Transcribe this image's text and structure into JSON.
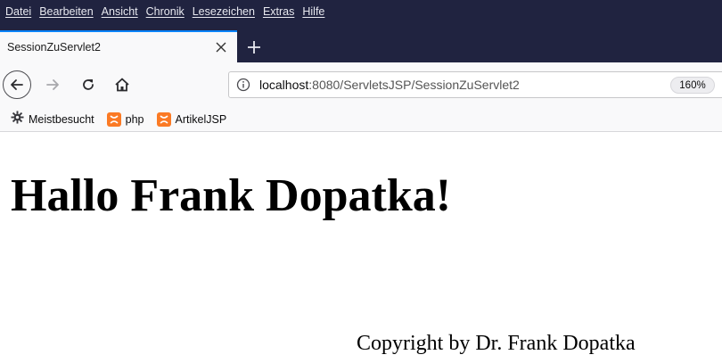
{
  "menubar": {
    "items": [
      {
        "label": "Datei"
      },
      {
        "label": "Bearbeiten"
      },
      {
        "label": "Ansicht"
      },
      {
        "label": "Chronik"
      },
      {
        "label": "Lesezeichen"
      },
      {
        "label": "Extras"
      },
      {
        "label": "Hilfe"
      }
    ]
  },
  "tabs": [
    {
      "title": "SessionZuServlet2",
      "active": true
    }
  ],
  "urlbar": {
    "host": "localhost",
    "path": ":8080/ServletsJSP/SessionZuServlet2",
    "zoom": "160%"
  },
  "bookmarks": [
    {
      "label": "Meistbesucht",
      "icon": "gear-icon"
    },
    {
      "label": "php",
      "icon": "xampp-icon"
    },
    {
      "label": "ArtikelJSP",
      "icon": "xampp-icon"
    }
  ],
  "page": {
    "heading": "Hallo Frank Dopatka!",
    "copyright": "Copyright by Dr. Frank Dopatka"
  },
  "colors": {
    "chrome_dark": "#202340",
    "toolbar": "#f9f9fa",
    "accent": "#0a84ff",
    "xampp": "#fb7a24"
  }
}
